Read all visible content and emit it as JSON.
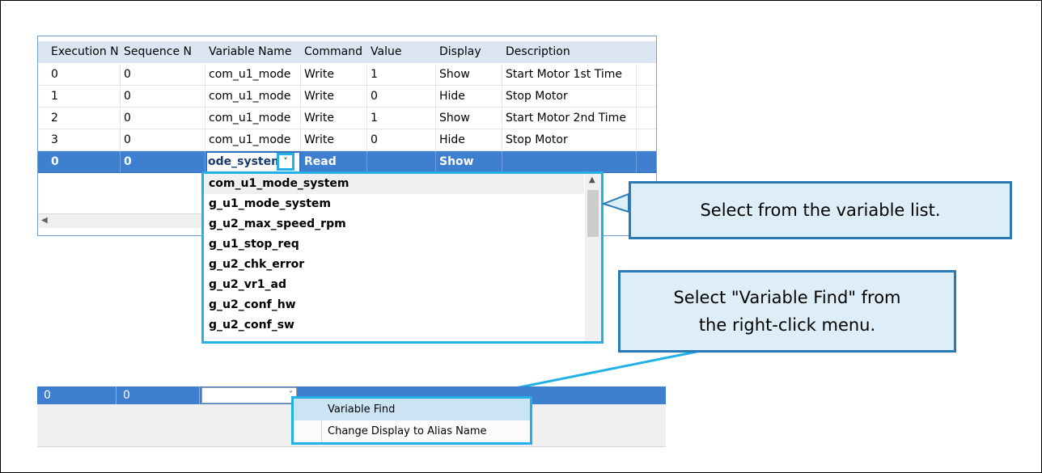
{
  "grid": {
    "columns": [
      "Execution N",
      "Sequence N",
      "Variable Name",
      "Command",
      "Value",
      "Display",
      "Description"
    ],
    "rows": [
      [
        "0",
        "0",
        "com_u1_mode",
        "Write",
        "1",
        "Show",
        "Start Motor 1st Time"
      ],
      [
        "1",
        "0",
        "com_u1_mode",
        "Write",
        "0",
        "Hide",
        "Stop Motor"
      ],
      [
        "2",
        "0",
        "com_u1_mode",
        "Write",
        "1",
        "Show",
        "Start Motor 2nd Time"
      ],
      [
        "3",
        "0",
        "com_u1_mode",
        "Write",
        "0",
        "Hide",
        "Stop Motor"
      ]
    ],
    "selected_row": {
      "execution": "0",
      "sequence": "0",
      "variable_text": "ode_system",
      "command": "Read",
      "value": "",
      "display": "Show",
      "description": ""
    },
    "dropdown_arrow": "˅"
  },
  "variable_list": [
    "com_u1_mode_system",
    "g_u1_mode_system",
    "g_u2_max_speed_rpm",
    "g_u1_stop_req",
    "g_u2_chk_error",
    "g_u2_vr1_ad",
    "g_u2_conf_hw",
    "g_u2_conf_sw"
  ],
  "callouts": {
    "select_list": "Select from the variable list.",
    "variable_find_line1": "Select \"Variable Find\" from",
    "variable_find_line2": "the right-click menu."
  },
  "bottom_row": {
    "execution": "0",
    "sequence": "0",
    "arrow": "˅"
  },
  "context_menu": {
    "items": [
      "Variable Find",
      "Change Display to Alias Name"
    ]
  },
  "colors": {
    "selection": "#3f7fd0",
    "highlight_border": "#22b0e6",
    "callout_fill": "#ddeef8",
    "callout_border": "#2b7ab8"
  }
}
